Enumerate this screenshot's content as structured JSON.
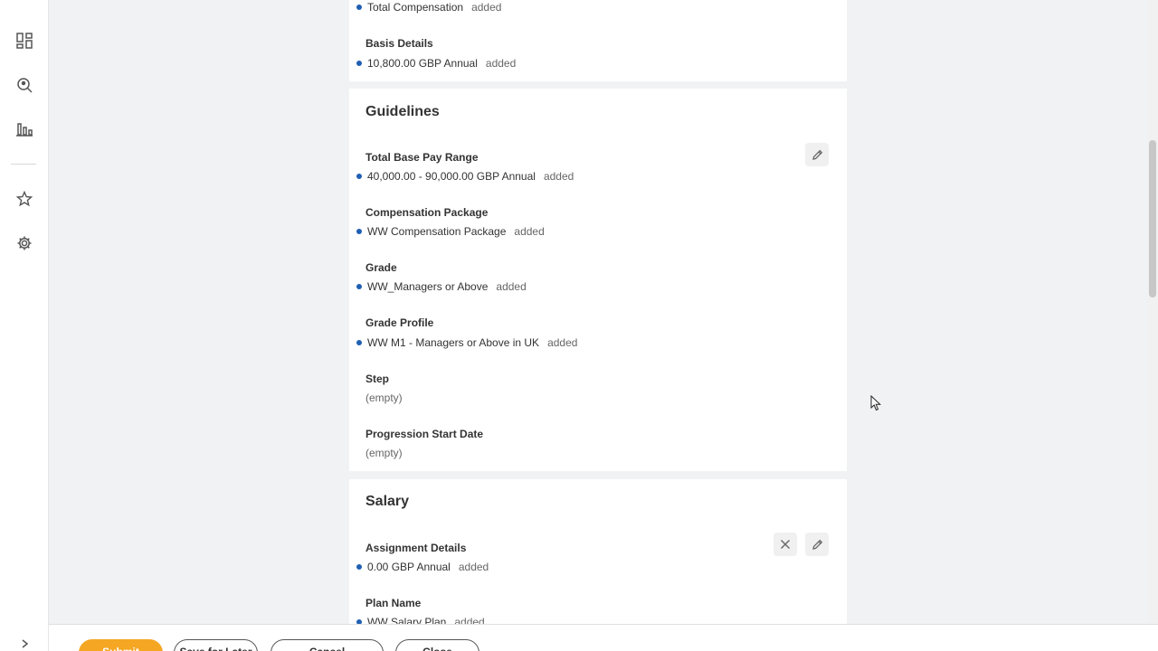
{
  "sidebar": {
    "icons": [
      "dashboard-icon",
      "search-person-icon",
      "bar-chart-icon",
      "star-icon",
      "gear-icon"
    ],
    "expand_icon": "chevron-right-icon"
  },
  "basis_card": {
    "total_comp": {
      "value": "Total Compensation",
      "change": "added"
    },
    "basis_details": {
      "label": "Basis Details",
      "value": "10,800.00 GBP Annual",
      "change": "added"
    }
  },
  "guidelines": {
    "title": "Guidelines",
    "fields": [
      {
        "label": "Total Base Pay Range",
        "value": "40,000.00 - 90,000.00 GBP Annual",
        "change": "added"
      },
      {
        "label": "Compensation Package",
        "value": "WW Compensation Package",
        "change": "added"
      },
      {
        "label": "Grade",
        "value": "WW_Managers or Above",
        "change": "added"
      },
      {
        "label": "Grade Profile",
        "value": "WW M1 - Managers or Above in UK",
        "change": "added"
      },
      {
        "label": "Step",
        "value": "(empty)"
      },
      {
        "label": "Progression Start Date",
        "value": "(empty)"
      }
    ]
  },
  "salary": {
    "title": "Salary",
    "fields": [
      {
        "label": "Assignment Details",
        "value": "0.00 GBP Annual",
        "change": "added"
      },
      {
        "label": "Plan Name",
        "value": "WW Salary Plan",
        "change": "added"
      }
    ]
  },
  "footer": {
    "buttons": [
      "Submit",
      "Save for Later",
      "Cancel",
      "Close"
    ]
  },
  "colors": {
    "accent": "#1f5fb3",
    "primary_button": "#f5a623"
  }
}
